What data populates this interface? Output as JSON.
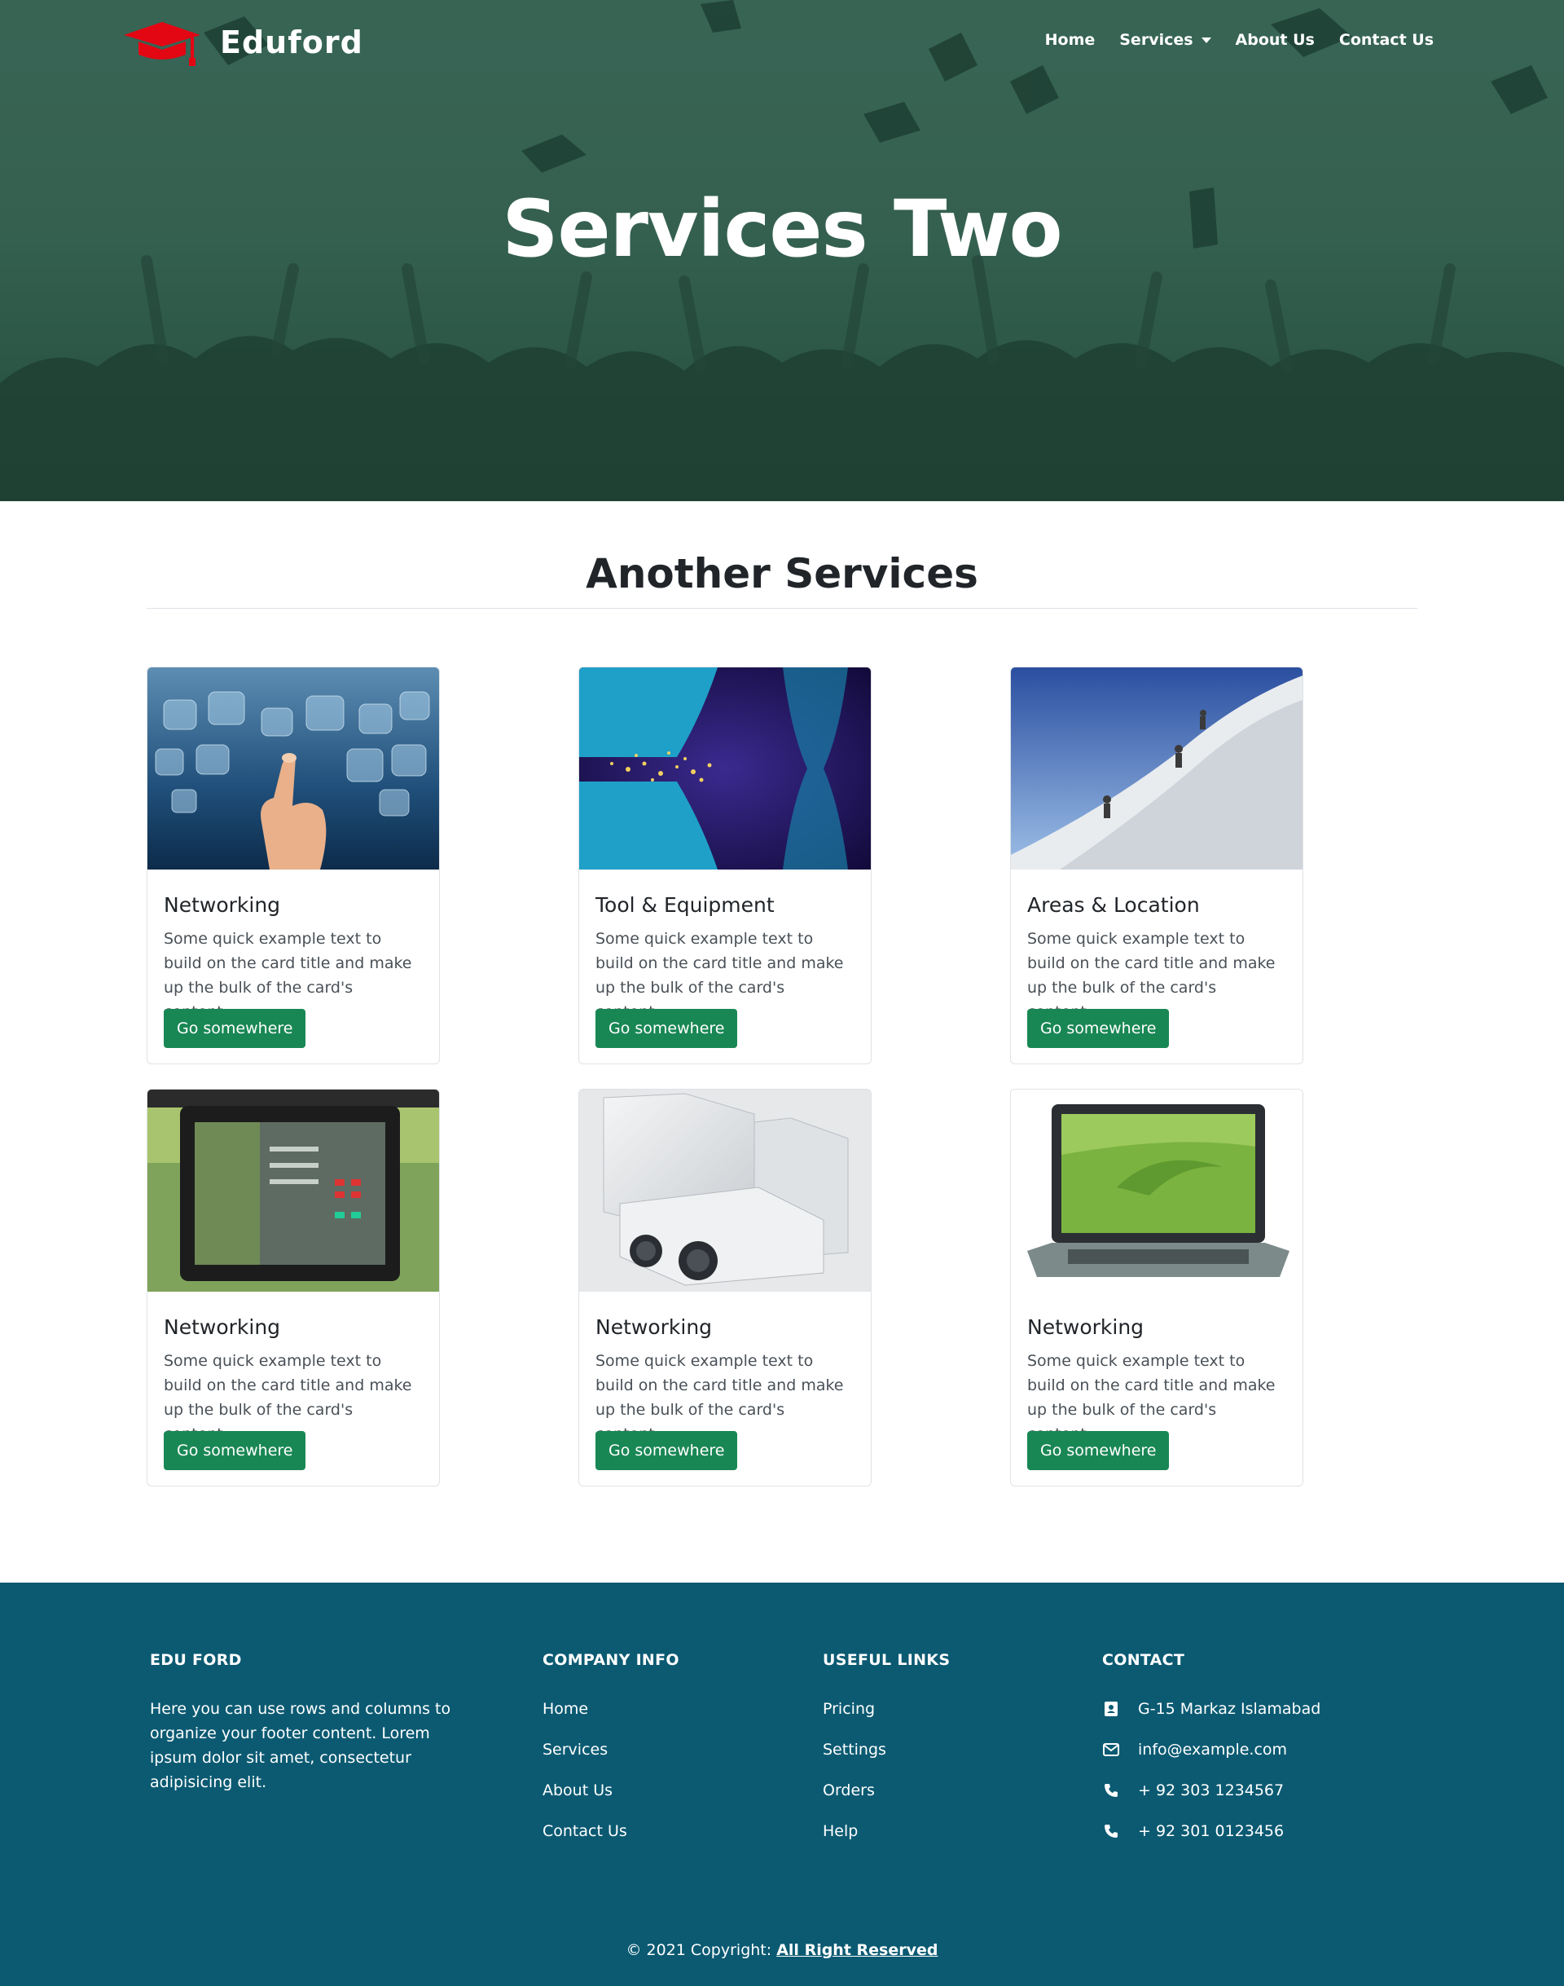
{
  "brand": {
    "name": "Eduford"
  },
  "nav": {
    "home": "Home",
    "services": "Services",
    "about": "About Us",
    "contact": "Contact Us"
  },
  "hero": {
    "title": "Services Two"
  },
  "section": {
    "title": "Another Services"
  },
  "cards": [
    {
      "title": "Networking",
      "text": "Some quick example text to build on the card title and make up the bulk of the card's content.",
      "button": "Go somewhere"
    },
    {
      "title": "Tool & Equipment",
      "text": "Some quick example text to build on the card title and make up the bulk of the card's content.",
      "button": "Go somewhere"
    },
    {
      "title": "Areas & Location",
      "text": "Some quick example text to build on the card title and make up the bulk of the card's content.",
      "button": "Go somewhere"
    },
    {
      "title": "Networking",
      "text": "Some quick example text to build on the card title and make up the bulk of the card's content.",
      "button": "Go somewhere"
    },
    {
      "title": "Networking",
      "text": "Some quick example text to build on the card title and make up the bulk of the card's content.",
      "button": "Go somewhere"
    },
    {
      "title": "Networking",
      "text": "Some quick example text to build on the card title and make up the bulk of the card's content.",
      "button": "Go somewhere"
    }
  ],
  "footer": {
    "about_heading": "EDU FORD",
    "about_text": "Here you can use rows and columns to organize your footer content. Lorem ipsum dolor sit amet, consectetur adipisicing elit.",
    "company_heading": "COMPANY INFO",
    "company_links": [
      "Home",
      "Services",
      "About Us",
      "Contact Us"
    ],
    "useful_heading": "USEFUL LINKS",
    "useful_links": [
      "Pricing",
      "Settings",
      "Orders",
      "Help"
    ],
    "contact_heading": "CONTACT",
    "contact": [
      "G-15 Markaz Islamabad",
      "info@example.com",
      "+ 92 303 1234567",
      "+ 92 301 0123456"
    ],
    "copyright_prefix": "© 2021 Copyright:",
    "copyright_link": "All Right Reserved"
  },
  "colors": {
    "hero_green": "#3f6a5a",
    "button_green": "#198754",
    "footer_teal": "#0b5a72",
    "logo_red": "#e30613"
  }
}
